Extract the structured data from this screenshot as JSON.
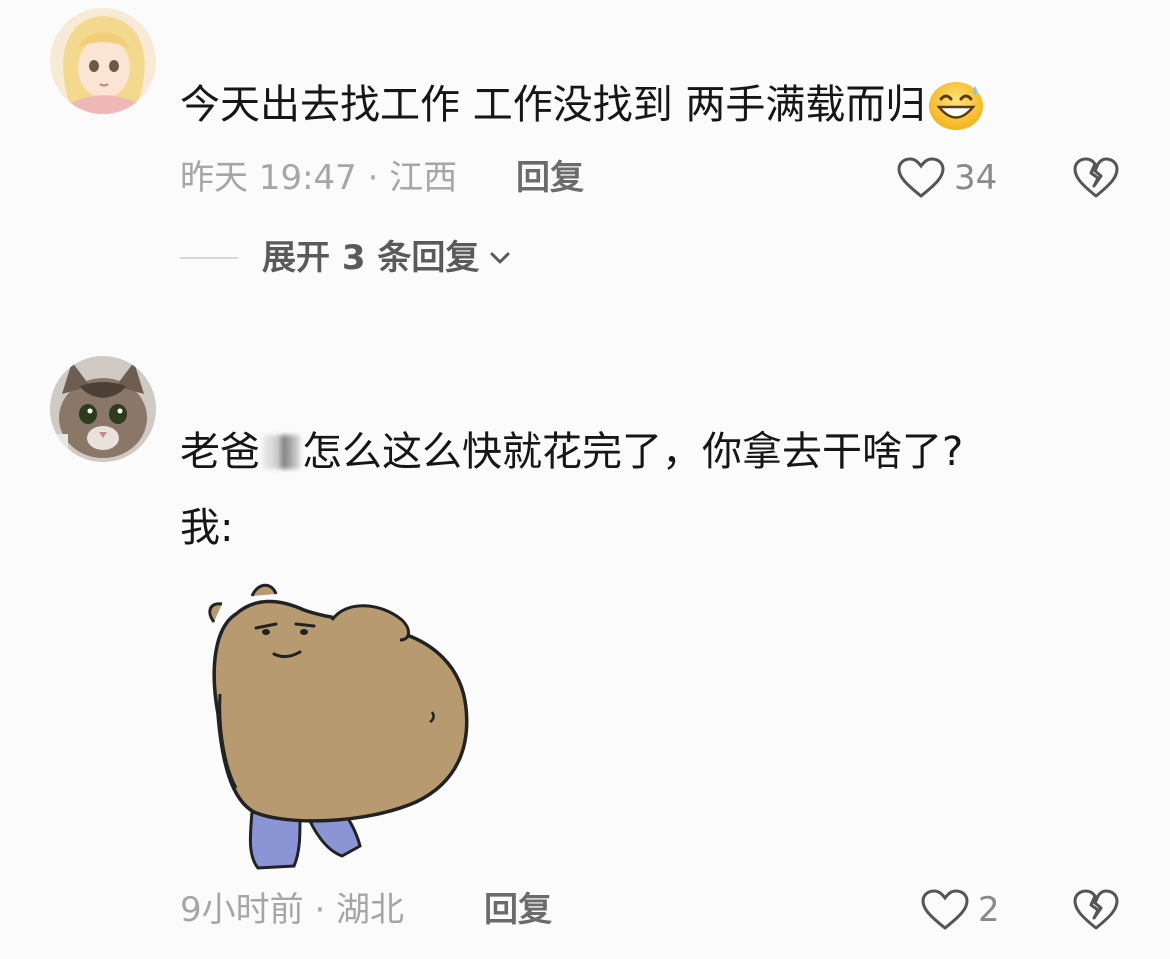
{
  "comments": [
    {
      "text": "今天出去找工作 工作没找到 两手满载而归",
      "emoji_icon": "grinning-sweat-emoji-icon",
      "meta": "昨天 19:47 · 江西",
      "reply_label": "回复",
      "like_count": "34",
      "expand_replies_label": "展开 3 条回复"
    },
    {
      "text_part1": "老爸",
      "text_part2": "怎么这么快就花完了，你拿去干啥了?",
      "text_line2": "我:",
      "sticker_icon": "fat-bear-meme-sticker-icon",
      "meta": "9小时前 · 湖北",
      "reply_label": "回复",
      "like_count": "2"
    }
  ],
  "colors": {
    "background": "#fbfbfb",
    "text": "#161616",
    "meta_text": "#a6a6a6",
    "icon_stroke": "#555555"
  }
}
